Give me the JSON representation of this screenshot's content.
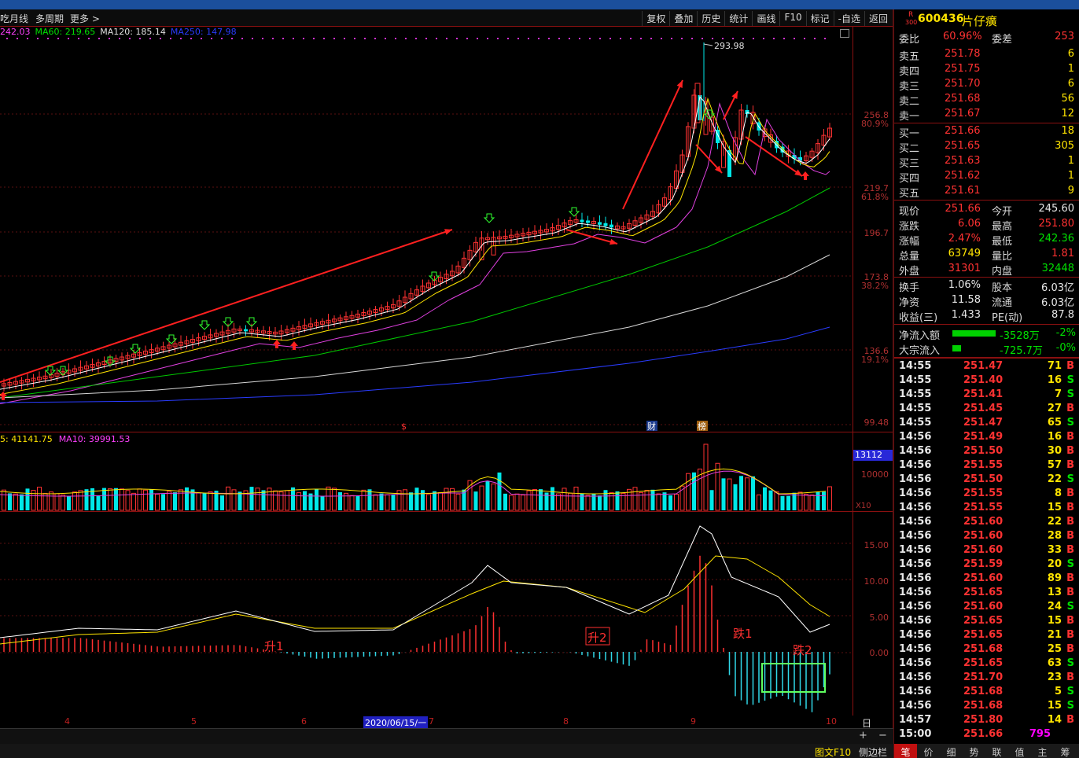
{
  "toolbar": {
    "left": [
      "月线",
      "多周期",
      "更多 >"
    ],
    "right": [
      "复权",
      "叠加",
      "历史",
      "统计",
      "画线",
      "F10",
      "标记",
      "-自选",
      "返回"
    ]
  },
  "ma_line": [
    {
      "text": "242.03",
      "color": "#ff40ff"
    },
    {
      "text": "MA60: 219.65",
      "color": "#00e000"
    },
    {
      "text": "MA120: 185.14",
      "color": "#e0e0e0"
    },
    {
      "text": "MA250: 147.98",
      "color": "#2a3cff"
    }
  ],
  "vol_line": [
    {
      "text": "5: 41141.75",
      "color": "#ffe400"
    },
    {
      "text": "MA10: 39991.53",
      "color": "#ff40ff"
    }
  ],
  "price_axis": [
    {
      "label": "256.8",
      "pct": "80.9%"
    },
    {
      "label": "219.7",
      "pct": "61.8%"
    },
    {
      "label": "196.7",
      "pct": ""
    },
    {
      "label": "173.8",
      "pct": "38.2%"
    },
    {
      "label": "136.6",
      "pct": "19.1%"
    },
    {
      "label": "99.48",
      "pct": ""
    }
  ],
  "vol_axis": {
    "highlight": "13112",
    "mid": "10000",
    "unit": "X10"
  },
  "macd_axis": [
    "15.00",
    "10.00",
    "5.00",
    "0.00"
  ],
  "chart_notes": {
    "peak": "293.98",
    "markers": [
      "$",
      "财",
      "榜"
    ],
    "macd_labels": [
      "升1",
      "升2",
      "跌1",
      "跌2"
    ]
  },
  "date_axis": {
    "labels": [
      "4",
      "5",
      "6",
      "7",
      "8",
      "9",
      "10"
    ],
    "cursor": "2020/06/15/一",
    "period": "日线"
  },
  "stock": {
    "badge_top": "R",
    "badge_bottom": "300",
    "code": "600436",
    "name": "片仔癀"
  },
  "order_ratio": {
    "label1": "委比",
    "value1": "60.96%",
    "label2": "委差",
    "value2": "253"
  },
  "asks": [
    {
      "label": "卖五",
      "price": "251.78",
      "vol": "6"
    },
    {
      "label": "卖四",
      "price": "251.75",
      "vol": "1"
    },
    {
      "label": "卖三",
      "price": "251.70",
      "vol": "6"
    },
    {
      "label": "卖二",
      "price": "251.68",
      "vol": "56"
    },
    {
      "label": "卖一",
      "price": "251.67",
      "vol": "12"
    }
  ],
  "bids": [
    {
      "label": "买一",
      "price": "251.66",
      "vol": "18"
    },
    {
      "label": "买二",
      "price": "251.65",
      "vol": "305"
    },
    {
      "label": "买三",
      "price": "251.63",
      "vol": "1"
    },
    {
      "label": "买四",
      "price": "251.62",
      "vol": "1"
    },
    {
      "label": "买五",
      "price": "251.61",
      "vol": "9"
    }
  ],
  "stats": [
    {
      "l1": "现价",
      "v1": "251.66",
      "c1": "red",
      "l2": "今开",
      "v2": "245.60",
      "c2": "white"
    },
    {
      "l1": "涨跌",
      "v1": "6.06",
      "c1": "red",
      "l2": "最高",
      "v2": "251.80",
      "c2": "red"
    },
    {
      "l1": "涨幅",
      "v1": "2.47%",
      "c1": "red",
      "l2": "最低",
      "v2": "242.36",
      "c2": "green"
    },
    {
      "l1": "总量",
      "v1": "63749",
      "c1": "yellow",
      "l2": "量比",
      "v2": "1.81",
      "c2": "red"
    },
    {
      "l1": "外盘",
      "v1": "31301",
      "c1": "red",
      "l2": "内盘",
      "v2": "32448",
      "c2": "green"
    },
    {
      "l1": "换手",
      "v1": "1.06%",
      "c1": "white",
      "l2": "股本",
      "v2": "6.03亿",
      "c2": "white"
    },
    {
      "l1": "净资",
      "v1": "11.58",
      "c1": "white",
      "l2": "流通",
      "v2": "6.03亿",
      "c2": "white"
    },
    {
      "l1": "收益(三)",
      "v1": "1.433",
      "c1": "white",
      "l2": "PE(动)",
      "v2": "87.8",
      "c2": "white"
    }
  ],
  "flows": [
    {
      "label": "净流入额",
      "value": "-3528万",
      "pct": "-2%",
      "bar": 1.0
    },
    {
      "label": "大宗流入",
      "value": "-725.7万",
      "pct": "-0%",
      "bar": 0.2
    }
  ],
  "ticks": [
    {
      "t": "14:55",
      "p": "251.47",
      "v": "71",
      "s": "B"
    },
    {
      "t": "14:55",
      "p": "251.40",
      "v": "16",
      "s": "S"
    },
    {
      "t": "14:55",
      "p": "251.41",
      "v": "7",
      "s": "S"
    },
    {
      "t": "14:55",
      "p": "251.45",
      "v": "27",
      "s": "B"
    },
    {
      "t": "14:55",
      "p": "251.47",
      "v": "65",
      "s": "S"
    },
    {
      "t": "14:56",
      "p": "251.49",
      "v": "16",
      "s": "B"
    },
    {
      "t": "14:56",
      "p": "251.50",
      "v": "30",
      "s": "B"
    },
    {
      "t": "14:56",
      "p": "251.55",
      "v": "57",
      "s": "B"
    },
    {
      "t": "14:56",
      "p": "251.50",
      "v": "22",
      "s": "S"
    },
    {
      "t": "14:56",
      "p": "251.55",
      "v": "8",
      "s": "B"
    },
    {
      "t": "14:56",
      "p": "251.55",
      "v": "15",
      "s": "B"
    },
    {
      "t": "14:56",
      "p": "251.60",
      "v": "22",
      "s": "B"
    },
    {
      "t": "14:56",
      "p": "251.60",
      "v": "28",
      "s": "B"
    },
    {
      "t": "14:56",
      "p": "251.60",
      "v": "33",
      "s": "B"
    },
    {
      "t": "14:56",
      "p": "251.59",
      "v": "20",
      "s": "S"
    },
    {
      "t": "14:56",
      "p": "251.60",
      "v": "89",
      "s": "B"
    },
    {
      "t": "14:56",
      "p": "251.65",
      "v": "13",
      "s": "B"
    },
    {
      "t": "14:56",
      "p": "251.60",
      "v": "24",
      "s": "S"
    },
    {
      "t": "14:56",
      "p": "251.65",
      "v": "15",
      "s": "B"
    },
    {
      "t": "14:56",
      "p": "251.65",
      "v": "21",
      "s": "B"
    },
    {
      "t": "14:56",
      "p": "251.68",
      "v": "25",
      "s": "B"
    },
    {
      "t": "14:56",
      "p": "251.65",
      "v": "63",
      "s": "S"
    },
    {
      "t": "14:56",
      "p": "251.70",
      "v": "23",
      "s": "B"
    },
    {
      "t": "14:56",
      "p": "251.68",
      "v": "5",
      "s": "S"
    },
    {
      "t": "14:56",
      "p": "251.68",
      "v": "15",
      "s": "S"
    },
    {
      "t": "14:57",
      "p": "251.80",
      "v": "14",
      "s": "B"
    },
    {
      "t": "15:00",
      "p": "251.66",
      "v": "795",
      "s": ""
    }
  ],
  "bottom_tabs": [
    "笔",
    "价",
    "细",
    "势",
    "联",
    "值",
    "主",
    "筹"
  ],
  "status": {
    "left": "图文F10",
    "right": "侧边栏"
  }
}
